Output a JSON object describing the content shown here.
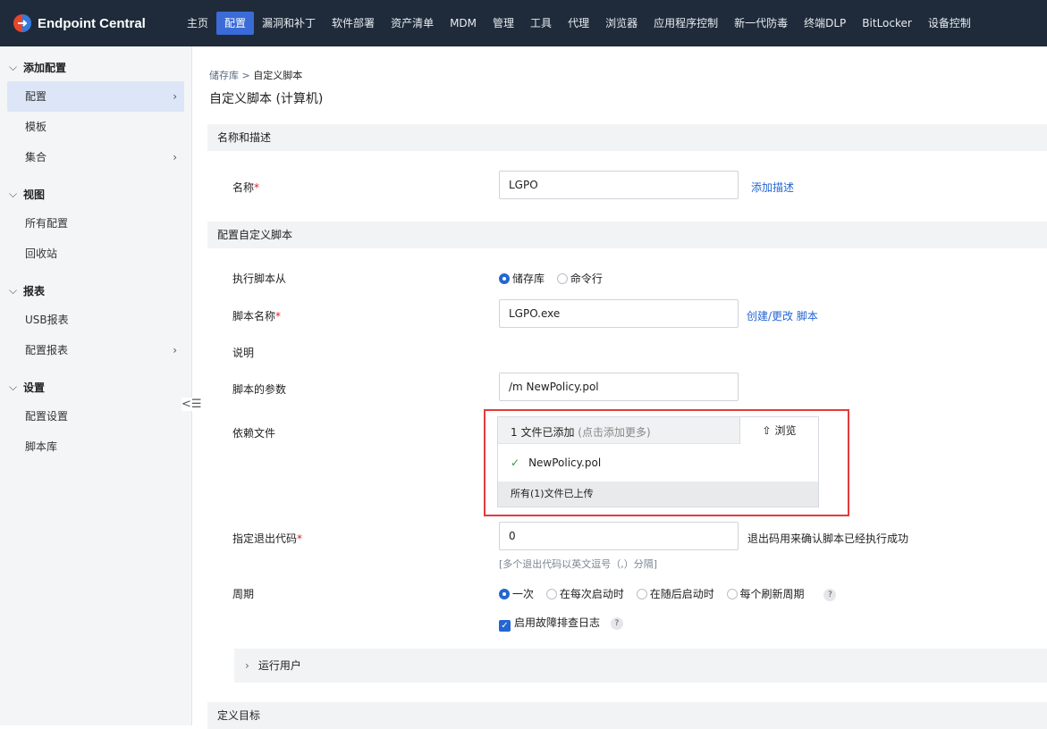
{
  "app": {
    "title": "Endpoint Central"
  },
  "nav": [
    "主页",
    "配置",
    "漏洞和补丁",
    "软件部署",
    "资产清单",
    "MDM",
    "管理",
    "工具",
    "代理",
    "浏览器",
    "应用程序控制",
    "新一代防毒",
    "终端DLP",
    "BitLocker",
    "设备控制"
  ],
  "nav_active": "配置",
  "sidebar": {
    "groups": [
      {
        "label": "添加配置",
        "items": [
          {
            "label": "配置",
            "active": true,
            "arrow": true
          },
          {
            "label": "模板"
          },
          {
            "label": "集合",
            "arrow": true
          }
        ]
      },
      {
        "label": "视图",
        "items": [
          {
            "label": "所有配置"
          },
          {
            "label": "回收站"
          }
        ]
      },
      {
        "label": "报表",
        "items": [
          {
            "label": "USB报表"
          },
          {
            "label": "配置报表",
            "arrow": true
          }
        ]
      },
      {
        "label": "设置",
        "items": [
          {
            "label": "配置设置"
          },
          {
            "label": "脚本库"
          }
        ]
      }
    ]
  },
  "breadcrumb": {
    "root": "储存库",
    "sep": ">",
    "current": "自定义脚本"
  },
  "page_title": "自定义脚本 (计算机)",
  "sections": {
    "name_desc": "名称和描述",
    "config_script": "配置自定义脚本",
    "define_target": "定义目标"
  },
  "form": {
    "name_label": "名称",
    "name_value": "LGPO",
    "add_desc_link": "添加描述",
    "exec_from_label": "执行脚本从",
    "exec_options": [
      "储存库",
      "命令行"
    ],
    "script_name_label": "脚本名称",
    "script_name_value": "LGPO.exe",
    "create_script_link": "创建/更改 脚本",
    "desc_label": "说明",
    "params_label": "脚本的参数",
    "params_value": "/m NewPolicy.pol",
    "dep_label": "依赖文件",
    "upload_count": "1 文件已添加",
    "upload_more": "(点击添加更多)",
    "browse_label": "浏览",
    "uploaded_file": "NewPolicy.pol",
    "upload_status": "所有(1)文件已上传",
    "exit_code_label": "指定退出代码",
    "exit_code_value": "0",
    "exit_code_note": "退出码用来确认脚本已经执行成功",
    "exit_code_hint": "[多个退出代码以英文逗号（,）分隔]",
    "period_label": "周期",
    "period_options": [
      "一次",
      "在每次启动时",
      "在随后启动时",
      "每个刷新周期"
    ],
    "debug_log_label": "启用故障排查日志",
    "run_user_label": "运行用户"
  },
  "colors": {
    "topbar": "#1f2b3a",
    "accent": "#2466d1",
    "highlight": "#e23b3b"
  }
}
